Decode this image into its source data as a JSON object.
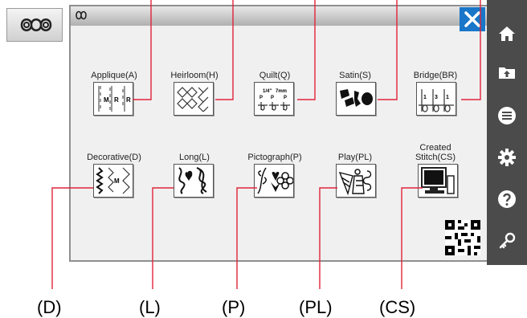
{
  "panel": {
    "close_icon": "close-icon",
    "title_icon": "stitch-category-icon"
  },
  "categories": [
    {
      "label": "Applique(A)",
      "icon": "applique-stitch-icon",
      "glyphs": [
        "M",
        "R",
        "R"
      ]
    },
    {
      "label": "Heirloom(H)",
      "icon": "heirloom-stitch-icon"
    },
    {
      "label": "Quilt(Q)",
      "icon": "quilt-stitch-icon",
      "glyphs": [
        "1/4\"",
        "7mm",
        "P",
        "P",
        "P"
      ]
    },
    {
      "label": "Satin(S)",
      "icon": "satin-stitch-icon"
    },
    {
      "label": "Bridge(BR)",
      "icon": "bridge-stitch-icon",
      "glyphs": [
        "1",
        "3",
        "1"
      ]
    },
    {
      "label": "Decorative(D)",
      "icon": "decorative-stitch-icon",
      "glyphs": [
        "M"
      ]
    },
    {
      "label": "Long(L)",
      "icon": "long-stitch-icon"
    },
    {
      "label": "Pictograph(P)",
      "icon": "pictograph-stitch-icon"
    },
    {
      "label": "Play(PL)",
      "icon": "play-stitch-icon"
    },
    {
      "label_line1": "Created",
      "label_line2": "Stitch(CS)",
      "icon": "computer-icon"
    }
  ],
  "sidebar": [
    "home-icon",
    "folder-upload-icon",
    "menu-icon",
    "gear-icon",
    "help-icon",
    "key-icon"
  ],
  "callouts": [
    "(D)",
    "(L)",
    "(P)",
    "(PL)",
    "(CS)"
  ],
  "colors": {
    "sidebar": "#4b4b4b",
    "close": "#1976c8",
    "callout_line": "#e0243a"
  }
}
